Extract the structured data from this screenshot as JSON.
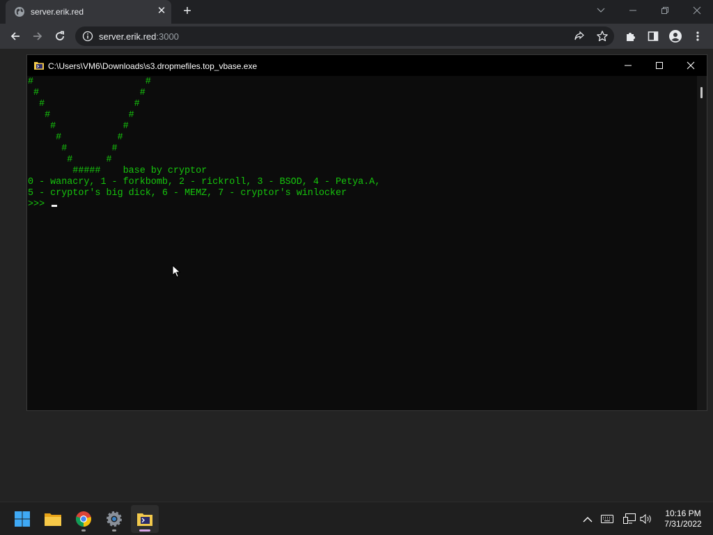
{
  "browser": {
    "tab": {
      "title": "server.erik.red",
      "favicon": "globe-icon"
    },
    "address": {
      "host": "server.erik.red",
      "port": ":3000"
    },
    "colors": {
      "frame": "#202124",
      "toolbar": "#35363a",
      "text": "#e8eaed"
    }
  },
  "console": {
    "title": "C:\\Users\\VM6\\Downloads\\s3.dropmefiles.top_vbase.exe",
    "output": "#                    #\n #                  #\n  #                #\n   #              #\n    #            #\n     #          #\n      #        #\n       #      #\n        #####    base by cryptor\n0 - wanacry, 1 - forkbomb, 2 - rickroll, 3 - BSOD, 4 - Petya.A,\n5 - cryptor's big dick, 6 - MEMZ, 7 - cryptor's winlocker",
    "prompt": ">>> ",
    "colors": {
      "background": "#0c0c0c",
      "text": "#16c60c"
    }
  },
  "taskbar": {
    "apps": [
      {
        "name": "start-icon"
      },
      {
        "name": "file-explorer-icon"
      },
      {
        "name": "chrome-icon"
      },
      {
        "name": "settings-icon"
      },
      {
        "name": "console-app-icon",
        "active": true
      }
    ],
    "clock": {
      "time": "10:16 PM",
      "date": "7/31/2022"
    }
  }
}
